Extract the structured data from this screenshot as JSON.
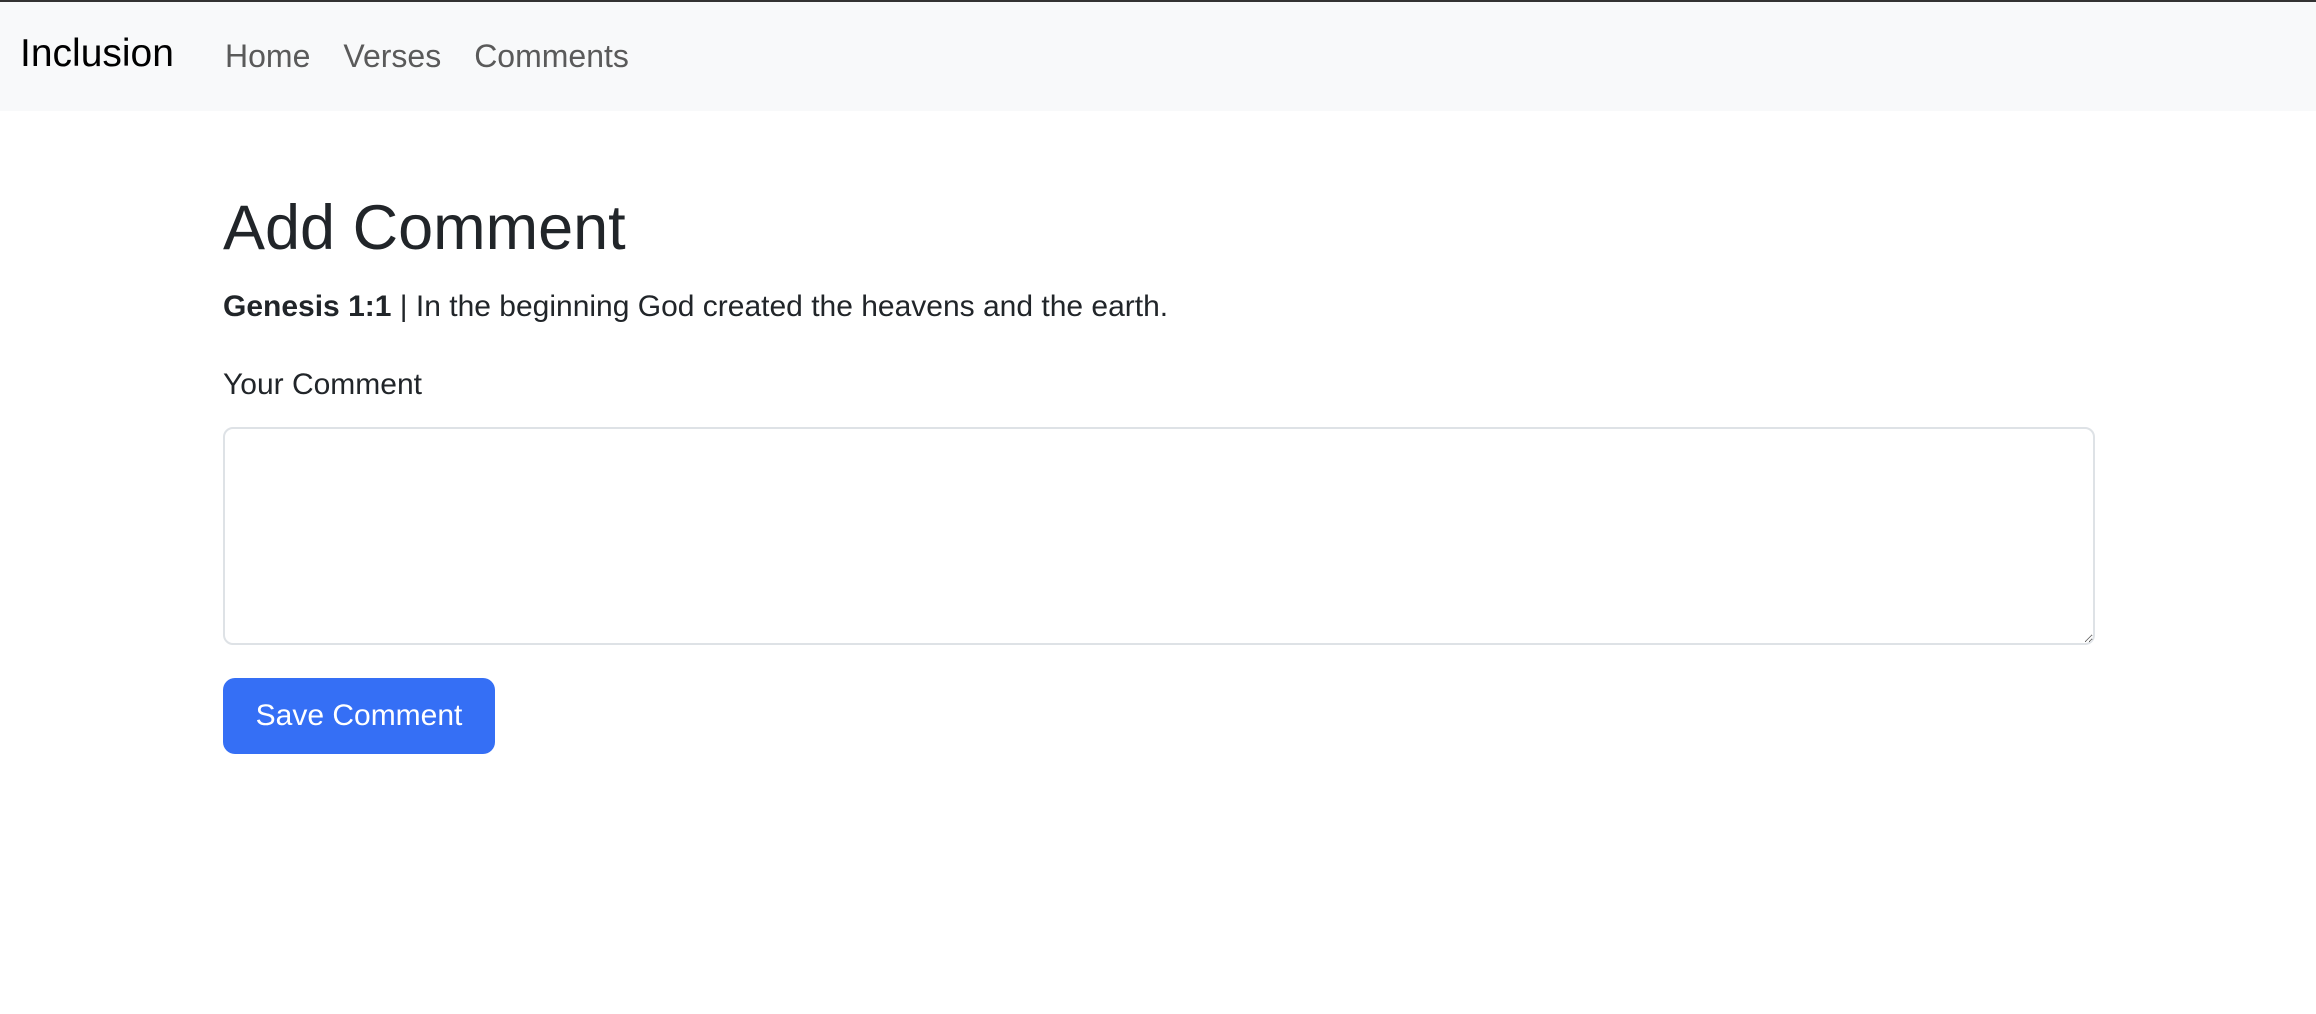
{
  "navbar": {
    "brand": "Inclusion",
    "links": [
      {
        "label": "Home"
      },
      {
        "label": "Verses"
      },
      {
        "label": "Comments"
      }
    ]
  },
  "page": {
    "title": "Add Comment",
    "verse_ref": "Genesis 1:1",
    "verse_separator": " | ",
    "verse_text": "In the beginning God created the heavens and the earth.",
    "comment_label": "Your Comment",
    "comment_value": "",
    "save_label": "Save Comment"
  },
  "colors": {
    "primary": "#356ff5",
    "navbar_bg": "#f8f9fa"
  }
}
